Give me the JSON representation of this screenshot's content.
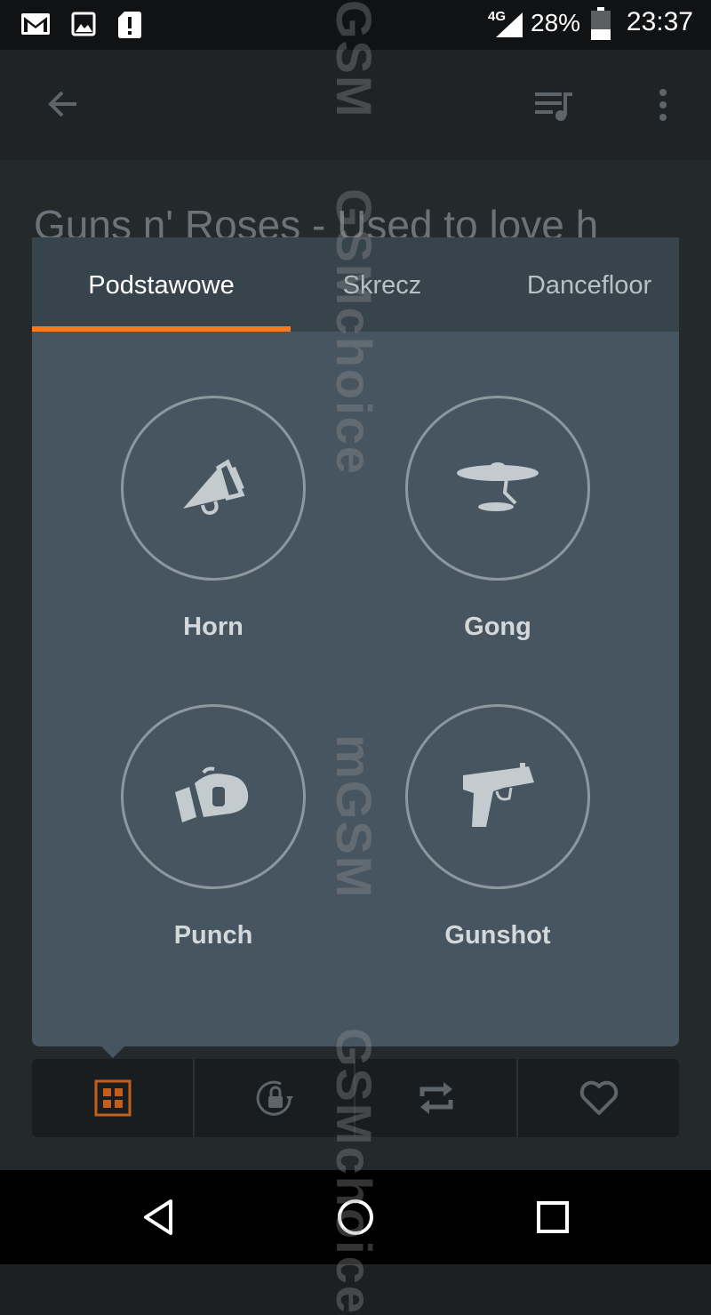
{
  "status_bar": {
    "network": "4G",
    "battery_percent": "28%",
    "time": "23:37"
  },
  "toolbar": {
    "back_icon": "arrow-left-icon",
    "queue_icon": "playlist-icon",
    "menu_icon": "more-vert-icon"
  },
  "song_title": "Guns n' Roses - Used to love h",
  "effects_panel": {
    "tabs": [
      {
        "label": "Podstawowe",
        "active": true
      },
      {
        "label": "Skrecz",
        "active": false
      },
      {
        "label": "Dancefloor",
        "active": false
      }
    ],
    "effects": [
      {
        "label": "Horn",
        "icon": "megaphone-icon"
      },
      {
        "label": "Gong",
        "icon": "gong-icon"
      },
      {
        "label": "Punch",
        "icon": "boxing-glove-icon"
      },
      {
        "label": "Gunshot",
        "icon": "pistol-icon"
      }
    ]
  },
  "control_bar": {
    "items": [
      {
        "icon": "effects-grid-icon",
        "active": true
      },
      {
        "icon": "rotation-lock-icon",
        "active": false
      },
      {
        "icon": "repeat-icon",
        "active": false
      },
      {
        "icon": "heart-icon",
        "active": false
      }
    ]
  },
  "nav_bar": {
    "back_icon": "nav-back-icon",
    "home_icon": "nav-home-icon",
    "recents_icon": "nav-recents-icon"
  },
  "watermarks": [
    "GSM",
    "GSMchoice",
    "mGSM",
    "GSMchoice"
  ],
  "colors": {
    "accent": "#f47b20",
    "panel": "#475560",
    "tab_bar": "#38444c"
  }
}
